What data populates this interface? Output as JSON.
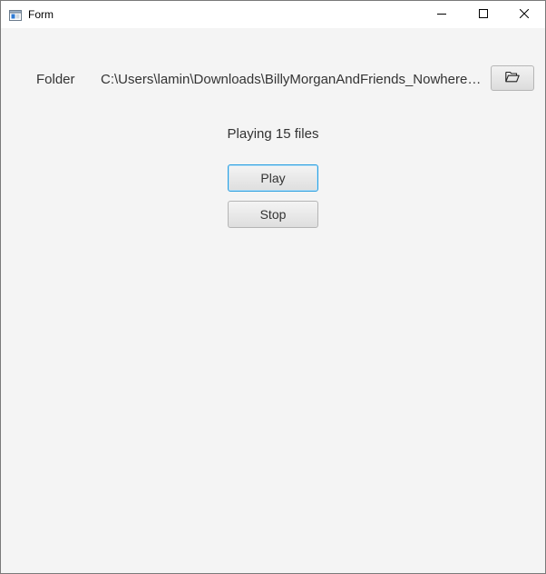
{
  "window": {
    "title": "Form",
    "icon": "app-window-icon",
    "controls": {
      "minimize_icon": "minimize-icon",
      "maximize_icon": "maximize-icon",
      "close_icon": "close-icon"
    }
  },
  "folder": {
    "label": "Folder",
    "path": "C:\\Users\\lamin\\Downloads\\BillyMorganAndFriends_Nowhere_...",
    "browse_icon": "folder-open-icon"
  },
  "status": {
    "text": "Playing 15 files"
  },
  "controls": {
    "play_label": "Play",
    "stop_label": "Stop"
  },
  "colors": {
    "background": "#f4f4f4",
    "titlebar": "#ffffff",
    "focus_border": "#2a9fe0",
    "text": "#333333"
  }
}
